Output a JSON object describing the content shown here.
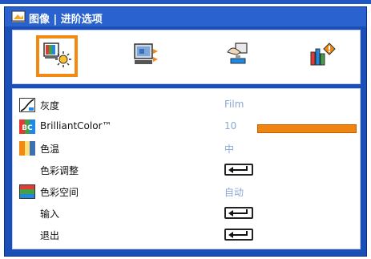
{
  "window": {
    "title": "图像 | 进阶选项"
  },
  "tabs": [
    {
      "name": "picture-tab",
      "icon": "picture-settings-icon",
      "selected": true
    },
    {
      "name": "display-tab",
      "icon": "screen-display-icon",
      "selected": false
    },
    {
      "name": "setup-tab",
      "icon": "setup-hand-icon",
      "selected": false
    },
    {
      "name": "options-tab",
      "icon": "options-info-icon",
      "selected": false
    }
  ],
  "menu": {
    "items": [
      {
        "icon": "gamma-curve-icon",
        "label": "灰度",
        "value": "Film"
      },
      {
        "icon": "brilliantcolor-icon",
        "label": "BrilliantColor™",
        "value": "10",
        "slider_percent": 100
      },
      {
        "icon": "color-temperature-icon",
        "label": "色温",
        "value": "中"
      },
      {
        "label": "色彩调整",
        "control": "enter-key-icon"
      },
      {
        "icon": "color-space-icon",
        "label": "色彩空间",
        "value": "自动"
      },
      {
        "label": "输入",
        "control": "enter-key-icon"
      },
      {
        "label": "退出",
        "control": "enter-key-icon"
      }
    ]
  },
  "colors": {
    "accent": "#f28a12",
    "panel": "#1b4fb8",
    "value_text": "#8aa8d4"
  }
}
